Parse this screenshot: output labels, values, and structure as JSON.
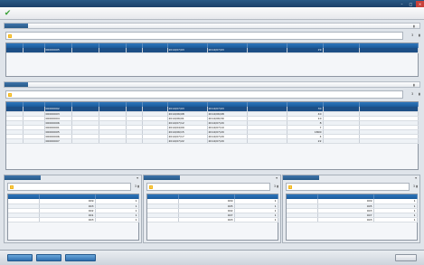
{
  "window": {
    "title": "",
    "minimize": "–",
    "maximize": "□",
    "close": "×"
  },
  "app": {
    "title": ""
  },
  "section1": {
    "tag": "",
    "message": "",
    "pin": "▮",
    "side": [
      "3",
      "▮"
    ],
    "columns": [
      "",
      "",
      "",
      "",
      "",
      "",
      "",
      "",
      "",
      "",
      "",
      "",
      ""
    ],
    "rows": [
      [
        "",
        "",
        "00000005",
        "",
        "",
        "",
        "",
        "2014/07/03",
        "2014/07/03",
        "",
        "29",
        "",
        ""
      ]
    ]
  },
  "section2": {
    "tag": "",
    "message": "",
    "pin": "▮",
    "side": [
      "3",
      "▮"
    ],
    "columns": [
      "",
      "",
      "",
      "",
      "",
      "",
      "",
      "",
      "",
      "",
      "",
      "",
      ""
    ],
    "rows": [
      [
        "",
        "",
        "00000002",
        "",
        "",
        "",
        "",
        "2014/07/03",
        "2014/07/03",
        "",
        "30",
        "",
        ""
      ],
      [
        "",
        "",
        "00000003",
        "",
        "",
        "",
        "",
        "2014/06/08",
        "2014/06/08",
        "",
        "40",
        "",
        ""
      ],
      [
        "",
        "",
        "00000004",
        "",
        "",
        "",
        "",
        "2014/06/01",
        "2014/06/30",
        "",
        "10",
        "",
        ""
      ],
      [
        "",
        "",
        "00000006",
        "",
        "",
        "",
        "",
        "2014/07/12",
        "2014/07/20",
        "",
        "8",
        "",
        ""
      ],
      [
        "",
        "",
        "00000001",
        "",
        "",
        "",
        "",
        "2014/04/09",
        "2014/07/10",
        "",
        "7",
        "",
        ""
      ],
      [
        "",
        "",
        "00000005",
        "",
        "",
        "",
        "",
        "2014/06/15",
        "2014/07/20",
        "",
        "1800",
        "",
        ""
      ],
      [
        "",
        "",
        "00000006",
        "",
        "",
        "",
        "",
        "2014/07/17",
        "2014/07/20",
        "",
        "4",
        "",
        ""
      ],
      [
        "",
        "",
        "00000007",
        "",
        "",
        "",
        "",
        "2014/07/22",
        "2014/07/20",
        "",
        "22",
        "",
        ""
      ]
    ]
  },
  "panels": [
    {
      "tag": "",
      "arrow": "▾",
      "message": "",
      "side": "3 ▮",
      "columns": [
        "",
        "",
        ""
      ],
      "rows": [
        [
          "",
          "009",
          "1"
        ],
        [
          "",
          "003",
          "1"
        ],
        [
          "",
          "002",
          "1"
        ],
        [
          "",
          "001",
          "1"
        ],
        [
          "",
          "003",
          "1"
        ]
      ]
    },
    {
      "tag": "",
      "arrow": "▾",
      "message": "",
      "side": "3 ▮",
      "columns": [
        "",
        "",
        ""
      ],
      "rows": [
        [
          "",
          "009",
          "1"
        ],
        [
          "",
          "005",
          "1"
        ],
        [
          "",
          "002",
          "1"
        ],
        [
          "",
          "007",
          "1"
        ],
        [
          "",
          "003",
          "1"
        ]
      ]
    },
    {
      "tag": "",
      "arrow": "▾",
      "message": "",
      "side": "3 ▮",
      "columns": [
        "",
        "",
        ""
      ],
      "rows": [
        [
          "",
          "009",
          "1"
        ],
        [
          "",
          "005",
          "1"
        ],
        [
          "",
          "003",
          "1"
        ],
        [
          "",
          "007",
          "1"
        ],
        [
          "",
          "003",
          "1"
        ]
      ]
    }
  ],
  "footer": {
    "btn1": "",
    "btn2": "",
    "btn3": "",
    "close": ""
  },
  "colors": {
    "header_blue": "#1a5a99",
    "selected_row": "#1d4f86",
    "tag_blue": "#275987",
    "warn": "#f2b619"
  }
}
